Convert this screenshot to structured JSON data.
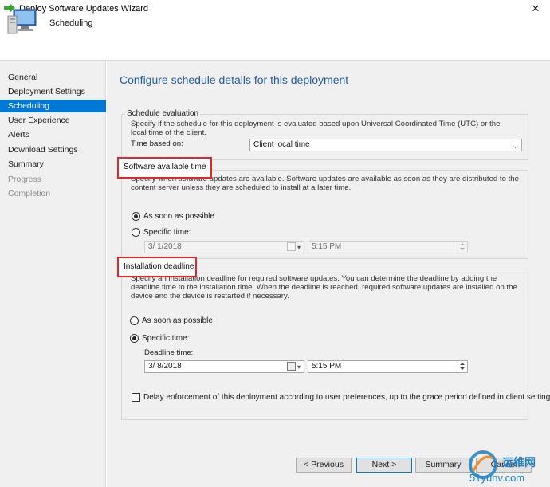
{
  "window": {
    "title": "Deploy Software Updates Wizard",
    "close_glyph": "✕"
  },
  "header": {
    "title": "Scheduling"
  },
  "sidebar": {
    "items": [
      {
        "label": "General",
        "state": "normal"
      },
      {
        "label": "Deployment Settings",
        "state": "normal"
      },
      {
        "label": "Scheduling",
        "state": "active"
      },
      {
        "label": "User Experience",
        "state": "normal"
      },
      {
        "label": "Alerts",
        "state": "normal"
      },
      {
        "label": "Download Settings",
        "state": "normal"
      },
      {
        "label": "Summary",
        "state": "normal"
      },
      {
        "label": "Progress",
        "state": "disabled"
      },
      {
        "label": "Completion",
        "state": "disabled"
      }
    ]
  },
  "main": {
    "heading": "Configure schedule details for this deployment",
    "schedule_evaluation": {
      "title": "Schedule evaluation",
      "description": "Specify if the schedule for this deployment is evaluated based upon Universal Coordinated Time (UTC) or the local time of the client.",
      "time_based_on_label": "Time based on:",
      "time_based_on_value": "Client local time"
    },
    "available_time": {
      "title": "Software available time",
      "description": "Specify when software updates are available. Software updates are available as soon as they are distributed to the content server unless they are scheduled to install at a later time.",
      "option_asap": "As soon as possible",
      "option_specific": "Specific time:",
      "date_value": "3/  1/2018",
      "time_value": "5:15 PM"
    },
    "deadline": {
      "title": "Installation deadline",
      "description": "Specify an installation deadline for required software updates. You can determine the deadline by adding the deadline time to the installation time. When the deadline is reached, required software updates are installed on the device and the device is restarted if necessary.",
      "option_asap": "As soon as possible",
      "option_specific": "Specific time:",
      "deadline_time_label": "Deadline time:",
      "date_value": "3/  8/2018",
      "time_value": "5:15 PM",
      "delay_label": "Delay enforcement of this deployment according to user preferences, up to the grace period defined in client settings."
    }
  },
  "buttons": {
    "previous": "< Previous",
    "next": "Next >",
    "summary": "Summary",
    "cancel": "Cancel"
  },
  "watermark": {
    "text_cn": "运维网",
    "text_url": "51yunv.com"
  },
  "colors": {
    "accent": "#0078d7",
    "heading": "#1f5ba5",
    "highlight": "#e5242b"
  }
}
